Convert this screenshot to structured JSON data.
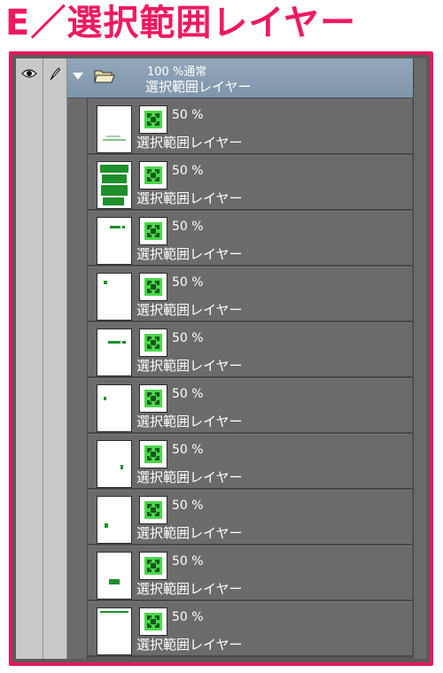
{
  "title": "E／選択範囲レイヤー",
  "icons": {
    "visibility": "eye-icon",
    "edit": "pen-icon",
    "folder": "folder-icon",
    "mask": "selection-mask-icon"
  },
  "colors": {
    "accent": "#e8175d",
    "mask_green": "#4ad64a",
    "panel_bg": "#5a5a5a",
    "folder_header": "#8aa0b5"
  },
  "folder": {
    "opacity_mode": "100 %通常",
    "name": "選択範囲レイヤー",
    "expanded": true
  },
  "layers": [
    {
      "opacity": "50 %",
      "name": "選択範囲レイヤー"
    },
    {
      "opacity": "50 %",
      "name": "選択範囲レイヤー"
    },
    {
      "opacity": "50 %",
      "name": "選択範囲レイヤー"
    },
    {
      "opacity": "50 %",
      "name": "選択範囲レイヤー"
    },
    {
      "opacity": "50 %",
      "name": "選択範囲レイヤー"
    },
    {
      "opacity": "50 %",
      "name": "選択範囲レイヤー"
    },
    {
      "opacity": "50 %",
      "name": "選択範囲レイヤー"
    },
    {
      "opacity": "50 %",
      "name": "選択範囲レイヤー"
    },
    {
      "opacity": "50 %",
      "name": "選択範囲レイヤー"
    },
    {
      "opacity": "50 %",
      "name": "選択範囲レイヤー"
    }
  ]
}
